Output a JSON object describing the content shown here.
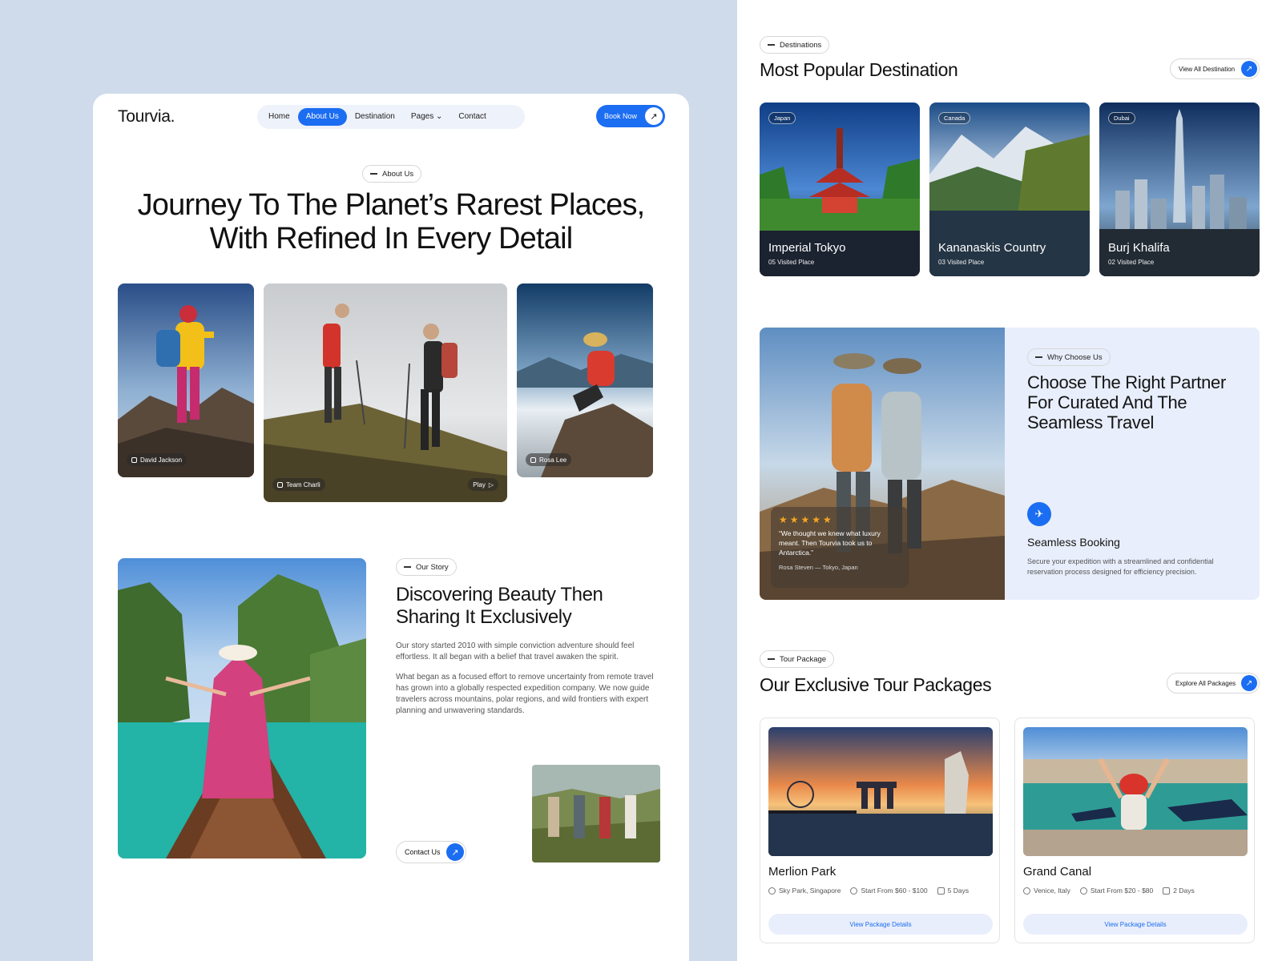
{
  "brand": "Tourvia.",
  "nav": {
    "items": [
      {
        "label": "Home",
        "active": false
      },
      {
        "label": "About Us",
        "active": true
      },
      {
        "label": "Destination",
        "active": false
      },
      {
        "label": "Pages ⌄",
        "active": false
      },
      {
        "label": "Contact",
        "active": false
      }
    ],
    "cta": "Book Now"
  },
  "hero": {
    "pill": "About Us",
    "title_line1": "Journey To The Planet’s Rarest Places,",
    "title_line2": "With Refined In Every Detail",
    "photos": [
      {
        "credit": "David Jackson"
      },
      {
        "credit": "Team Charli",
        "action": "Play"
      },
      {
        "credit": "Rosa Lee"
      }
    ]
  },
  "story": {
    "pill": "Our Story",
    "title_line1": "Discovering Beauty Then",
    "title_line2": "Sharing It Exclusively",
    "para1": "Our story started 2010 with simple conviction adventure should feel effortless. It all began with a belief that travel awaken the spirit.",
    "para2": "What began as a focused effort to remove uncertainty from remote travel has grown into a globally respected expedition company. We now guide travelers across mountains, polar regions, and wild frontiers with expert planning and unwavering standards.",
    "cta": "Contact Us"
  },
  "destinations": {
    "pill": "Destinations",
    "title": "Most Popular Destination",
    "cta": "View All Destination",
    "items": [
      {
        "country": "Japan",
        "name": "Imperial Tokyo",
        "visited": "05 Visited Place"
      },
      {
        "country": "Canada",
        "name": "Kananaskis Country",
        "visited": "03 Visited Place"
      },
      {
        "country": "Dubai",
        "name": "Burj Khalifa",
        "visited": "02 Visited Place"
      }
    ]
  },
  "why": {
    "pill": "Why Choose Us",
    "title_line1": "Choose The Right Partner",
    "title_line2": "For Curated And The",
    "title_line3": "Seamless Travel",
    "rating": "★★★★★",
    "quote": "“We thought we knew what luxury meant. Then Tourvia took us to Antarctica.”",
    "author": "Rosa Steven",
    "location": "Tokyo, Japan",
    "feature_title": "Seamless Booking",
    "feature_desc": "Secure your expedition with a streamlined and confidential reservation process designed for efficiency precision."
  },
  "packages": {
    "pill": "Tour Package",
    "title": "Our Exclusive Tour Packages",
    "cta": "Explore All Packages",
    "items": [
      {
        "name": "Merlion Park",
        "location": "Sky Park, Singapore",
        "price": "Start From $60 - $100",
        "duration": "5 Days",
        "button": "View Package Details"
      },
      {
        "name": "Grand Canal",
        "location": "Venice, Italy",
        "price": "Start From $20 - $80",
        "duration": "2 Days",
        "button": "View Package Details"
      }
    ]
  },
  "colors": {
    "accent": "#1b6df2",
    "left_background": "#cfdbea",
    "panel_tint": "#e8eefb",
    "star": "#f5a623"
  }
}
